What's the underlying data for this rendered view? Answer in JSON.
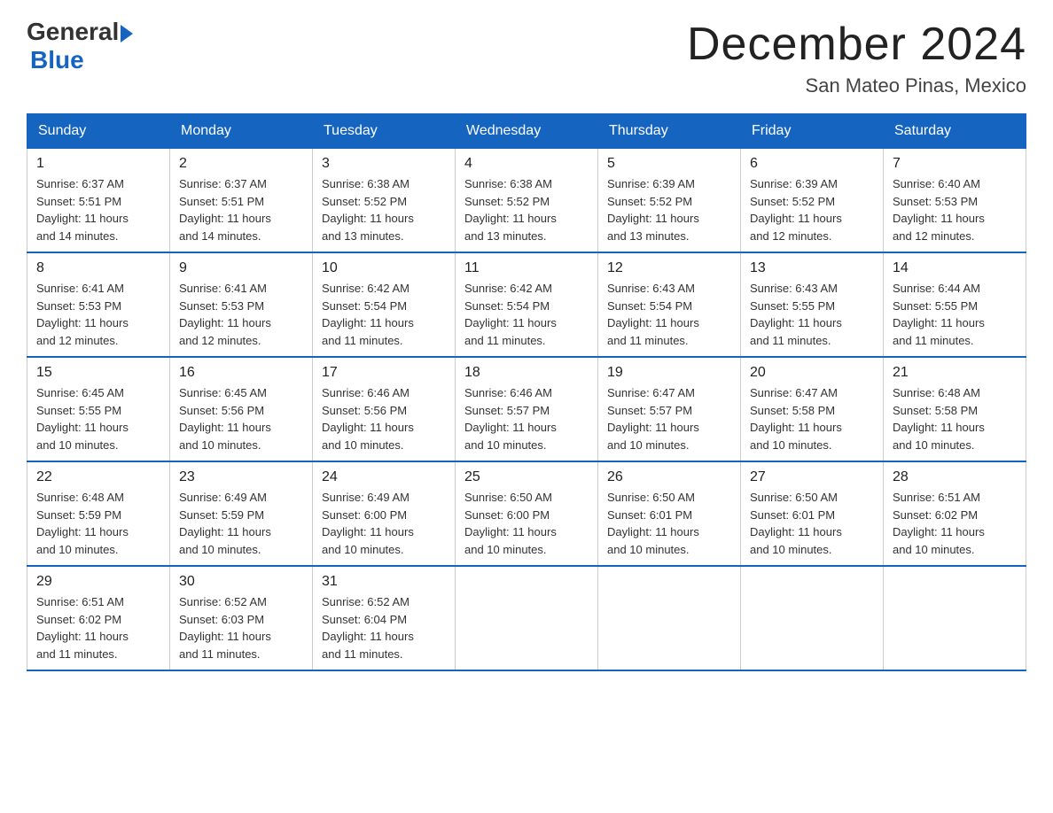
{
  "logo": {
    "text_general": "General",
    "text_blue": "Blue"
  },
  "title": "December 2024",
  "subtitle": "San Mateo Pinas, Mexico",
  "headers": [
    "Sunday",
    "Monday",
    "Tuesday",
    "Wednesday",
    "Thursday",
    "Friday",
    "Saturday"
  ],
  "weeks": [
    [
      {
        "day": "1",
        "sunrise": "6:37 AM",
        "sunset": "5:51 PM",
        "daylight": "11 hours and 14 minutes."
      },
      {
        "day": "2",
        "sunrise": "6:37 AM",
        "sunset": "5:51 PM",
        "daylight": "11 hours and 14 minutes."
      },
      {
        "day": "3",
        "sunrise": "6:38 AM",
        "sunset": "5:52 PM",
        "daylight": "11 hours and 13 minutes."
      },
      {
        "day": "4",
        "sunrise": "6:38 AM",
        "sunset": "5:52 PM",
        "daylight": "11 hours and 13 minutes."
      },
      {
        "day": "5",
        "sunrise": "6:39 AM",
        "sunset": "5:52 PM",
        "daylight": "11 hours and 13 minutes."
      },
      {
        "day": "6",
        "sunrise": "6:39 AM",
        "sunset": "5:52 PM",
        "daylight": "11 hours and 12 minutes."
      },
      {
        "day": "7",
        "sunrise": "6:40 AM",
        "sunset": "5:53 PM",
        "daylight": "11 hours and 12 minutes."
      }
    ],
    [
      {
        "day": "8",
        "sunrise": "6:41 AM",
        "sunset": "5:53 PM",
        "daylight": "11 hours and 12 minutes."
      },
      {
        "day": "9",
        "sunrise": "6:41 AM",
        "sunset": "5:53 PM",
        "daylight": "11 hours and 12 minutes."
      },
      {
        "day": "10",
        "sunrise": "6:42 AM",
        "sunset": "5:54 PM",
        "daylight": "11 hours and 11 minutes."
      },
      {
        "day": "11",
        "sunrise": "6:42 AM",
        "sunset": "5:54 PM",
        "daylight": "11 hours and 11 minutes."
      },
      {
        "day": "12",
        "sunrise": "6:43 AM",
        "sunset": "5:54 PM",
        "daylight": "11 hours and 11 minutes."
      },
      {
        "day": "13",
        "sunrise": "6:43 AM",
        "sunset": "5:55 PM",
        "daylight": "11 hours and 11 minutes."
      },
      {
        "day": "14",
        "sunrise": "6:44 AM",
        "sunset": "5:55 PM",
        "daylight": "11 hours and 11 minutes."
      }
    ],
    [
      {
        "day": "15",
        "sunrise": "6:45 AM",
        "sunset": "5:55 PM",
        "daylight": "11 hours and 10 minutes."
      },
      {
        "day": "16",
        "sunrise": "6:45 AM",
        "sunset": "5:56 PM",
        "daylight": "11 hours and 10 minutes."
      },
      {
        "day": "17",
        "sunrise": "6:46 AM",
        "sunset": "5:56 PM",
        "daylight": "11 hours and 10 minutes."
      },
      {
        "day": "18",
        "sunrise": "6:46 AM",
        "sunset": "5:57 PM",
        "daylight": "11 hours and 10 minutes."
      },
      {
        "day": "19",
        "sunrise": "6:47 AM",
        "sunset": "5:57 PM",
        "daylight": "11 hours and 10 minutes."
      },
      {
        "day": "20",
        "sunrise": "6:47 AM",
        "sunset": "5:58 PM",
        "daylight": "11 hours and 10 minutes."
      },
      {
        "day": "21",
        "sunrise": "6:48 AM",
        "sunset": "5:58 PM",
        "daylight": "11 hours and 10 minutes."
      }
    ],
    [
      {
        "day": "22",
        "sunrise": "6:48 AM",
        "sunset": "5:59 PM",
        "daylight": "11 hours and 10 minutes."
      },
      {
        "day": "23",
        "sunrise": "6:49 AM",
        "sunset": "5:59 PM",
        "daylight": "11 hours and 10 minutes."
      },
      {
        "day": "24",
        "sunrise": "6:49 AM",
        "sunset": "6:00 PM",
        "daylight": "11 hours and 10 minutes."
      },
      {
        "day": "25",
        "sunrise": "6:50 AM",
        "sunset": "6:00 PM",
        "daylight": "11 hours and 10 minutes."
      },
      {
        "day": "26",
        "sunrise": "6:50 AM",
        "sunset": "6:01 PM",
        "daylight": "11 hours and 10 minutes."
      },
      {
        "day": "27",
        "sunrise": "6:50 AM",
        "sunset": "6:01 PM",
        "daylight": "11 hours and 10 minutes."
      },
      {
        "day": "28",
        "sunrise": "6:51 AM",
        "sunset": "6:02 PM",
        "daylight": "11 hours and 10 minutes."
      }
    ],
    [
      {
        "day": "29",
        "sunrise": "6:51 AM",
        "sunset": "6:02 PM",
        "daylight": "11 hours and 11 minutes."
      },
      {
        "day": "30",
        "sunrise": "6:52 AM",
        "sunset": "6:03 PM",
        "daylight": "11 hours and 11 minutes."
      },
      {
        "day": "31",
        "sunrise": "6:52 AM",
        "sunset": "6:04 PM",
        "daylight": "11 hours and 11 minutes."
      },
      null,
      null,
      null,
      null
    ]
  ],
  "labels": {
    "sunrise": "Sunrise:",
    "sunset": "Sunset:",
    "daylight": "Daylight:"
  }
}
